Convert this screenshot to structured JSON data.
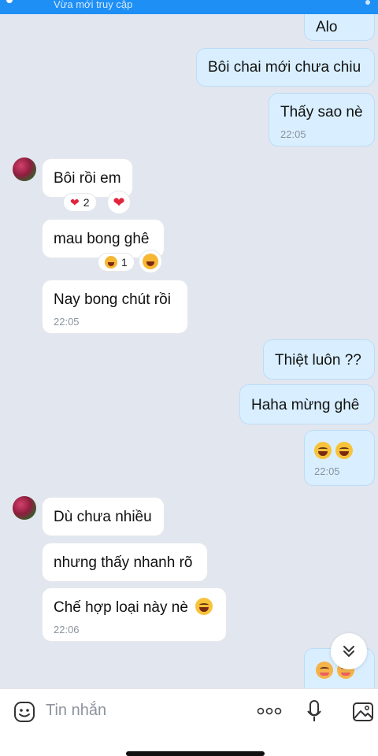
{
  "header": {
    "status_text": "Vừa mới truy cập"
  },
  "messages": {
    "m1": {
      "text": "Alo"
    },
    "m2": {
      "text": "Bôi chai mới chưa chiu"
    },
    "m3": {
      "text": "Thấy sao nè",
      "time": "22:05"
    },
    "m4": {
      "text": "Bôi rồi em",
      "reaction_count": "2"
    },
    "m5": {
      "text": "mau bong ghê",
      "reaction_count": "1"
    },
    "m6": {
      "text": "Nay bong chút rồi",
      "time": "22:05"
    },
    "m7": {
      "text": "Thiệt luôn ??"
    },
    "m8": {
      "text": "Haha mừng ghê"
    },
    "m9": {
      "emoji": "laughing-tears-emoji x2",
      "time": "22:05"
    },
    "m10": {
      "text": "Dù chưa nhiều"
    },
    "m11": {
      "text": "nhưng thấy nhanh rõ"
    },
    "m12": {
      "text": "Chế hợp loại này nè",
      "time": "22:06"
    },
    "m13": {
      "emoji": "blushing-faces"
    }
  },
  "composer": {
    "placeholder": "Tin nhắn",
    "icons": [
      "sticker-icon",
      "more-icon",
      "microphone-icon",
      "image-icon"
    ]
  },
  "colors": {
    "sent_bubble": "#d9efff",
    "recv_bubble": "#ffffff",
    "chat_bg": "#e2e6ef",
    "topbar": "#1e8ff5"
  }
}
